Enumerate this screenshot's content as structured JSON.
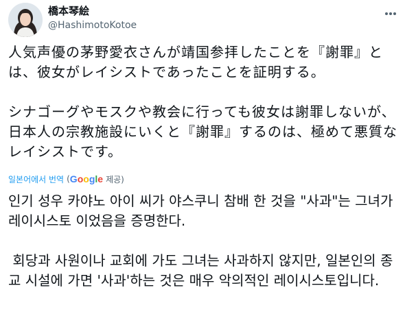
{
  "author": {
    "name": "橋本琴絵",
    "handle": "@HashimotoKotoe",
    "avatar_icon": "profile-photo-avatar"
  },
  "more_icon": "more-options-icon",
  "original_text": "人気声優の茅野愛衣さんが靖国参拝したことを『謝罪』とは、彼女がレイシストであったことを証明する。\n\nシナゴーグやモスクや教会に行っても彼女は謝罪しないが、日本人の宗教施設にいくと『謝罪』するのは、極めて悪質なレイシストです。",
  "translation": {
    "label": "일본어에서 번역",
    "open_paren": "(",
    "provider_logo": [
      "G",
      "o",
      "o",
      "g",
      "l",
      "e"
    ],
    "provider_suffix": "제공)",
    "text": "인기 성우 카야노 아이 씨가 야스쿠니 참배 한 것을 \"사과\"는 그녀가 레이시스토 이었음을 증명한다.\n\n 회당과 사원이나 교회에 가도 그녀는 사과하지 않지만, 일본인의 종교 시설에 가면 '사과'하는 것은 매우 악의적인 레이시스토입니다."
  },
  "colors": {
    "link": "#1d9bf0",
    "text": "#0f1419",
    "secondary": "#536471"
  }
}
